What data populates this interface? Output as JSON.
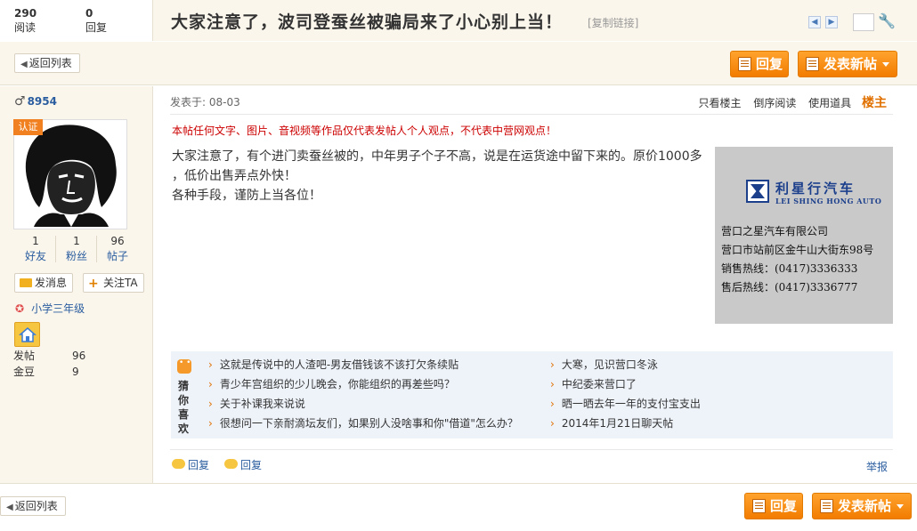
{
  "stats": {
    "views": {
      "num": "290",
      "label": "阅读"
    },
    "replies": {
      "num": "0",
      "label": "回复"
    }
  },
  "thread": {
    "title": "大家注意了，波司登蚕丝被骗局来了小心别上当！",
    "copy_link": "[复制链接]"
  },
  "toolbar": {
    "back": "返回列表",
    "reply": "回复",
    "new_post": "发表新帖"
  },
  "user": {
    "name": "8954",
    "cert": "认证",
    "friends": {
      "value": "1",
      "label": "好友"
    },
    "fans": {
      "value": "1",
      "label": "粉丝"
    },
    "posts": {
      "value": "96",
      "label": "帖子"
    },
    "msg_btn": "发消息",
    "follow_btn": "关注TA",
    "rank": "小学三年级",
    "fatie": {
      "label": "发帖",
      "value": "96"
    },
    "jindou": {
      "label": "金豆",
      "value": "9"
    }
  },
  "post": {
    "posted": "发表于: 08-03",
    "tools": [
      "只看楼主",
      "倒序阅读",
      "使用道具"
    ],
    "floor": "楼主",
    "notice": "本帖任何文字、图片、音视频等作品仅代表发帖人个人观点，不代表中营网观点！",
    "lines": [
      "大家注意了，有个进门卖蚕丝被的，中年男子个子不高，说是在运货途中留下来的。原价1000多",
      "，低价出售弄点外快！",
      "各种手段，谨防上当各位！"
    ],
    "report": "举报",
    "reply_links": [
      "回复",
      "回复"
    ]
  },
  "ad": {
    "brand": "利星行汽车",
    "brand_en": "LEI SHING HONG AUTO",
    "lines": [
      "营口之星汽车有限公司",
      "营口市站前区金牛山大街东98号",
      "销售热线：(0417)3336333",
      "售后热线：(0417)3336777"
    ]
  },
  "recommend": {
    "label": "猜你喜欢",
    "left": [
      "这就是传说中的人渣吧-男友借钱该不该打欠条续贴",
      "青少年宫组织的少儿晚会，你能组织的再差些吗？",
      "关于补课我来说说",
      "很想问一下亲耐滴坛友们，如果别人没啥事和你\"借道\"怎么办？"
    ],
    "right": [
      "大寒，见识营口冬泳",
      "中纪委来营口了",
      "晒一晒去年一年的支付宝支出",
      "2014年1月21日聊天帖"
    ]
  },
  "colors": {
    "accent": "#f27c00",
    "link": "#2a5d9f",
    "notice": "#cc0000",
    "panel_bg": "#fbf6ec"
  }
}
